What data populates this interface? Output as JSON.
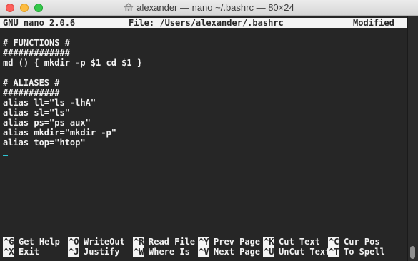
{
  "window": {
    "title": "alexander — nano ~/.bashrc — 80×24",
    "icon": "home-folder-icon"
  },
  "nano": {
    "version": "GNU nano 2.0.6",
    "file": "File: /Users/alexander/.bashrc",
    "state": "Modified"
  },
  "buffer": {
    "lines": [
      "",
      "# FUNCTIONS #",
      "#############",
      "md () { mkdir -p $1 cd $1 }",
      "",
      "# ALIASES #",
      "###########",
      "alias ll=\"ls -lhA\"",
      "alias sl=\"ls\"",
      "alias ps=\"ps aux\"",
      "alias mkdir=\"mkdir -p\"",
      "alias top=\"htop\""
    ]
  },
  "shortcuts": {
    "row1": [
      {
        "key": "^G",
        "label": "Get Help"
      },
      {
        "key": "^O",
        "label": "WriteOut"
      },
      {
        "key": "^R",
        "label": "Read File"
      },
      {
        "key": "^Y",
        "label": "Prev Page"
      },
      {
        "key": "^K",
        "label": "Cut Text"
      },
      {
        "key": "^C",
        "label": "Cur Pos"
      }
    ],
    "row2": [
      {
        "key": "^X",
        "label": "Exit"
      },
      {
        "key": "^J",
        "label": "Justify"
      },
      {
        "key": "^W",
        "label": "Where Is"
      },
      {
        "key": "^V",
        "label": "Next Page"
      },
      {
        "key": "^U",
        "label": "UnCut Text"
      },
      {
        "key": "^T",
        "label": "To Spell"
      }
    ]
  },
  "colors": {
    "background": "#262626",
    "text": "#f2f2f2",
    "inverse_bg": "#f4f4f4",
    "cursor": "#2ec5d3"
  }
}
